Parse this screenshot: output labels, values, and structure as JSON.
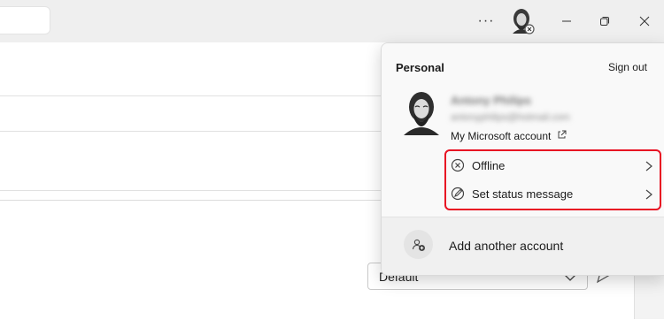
{
  "titlebar": {
    "more_label": "···",
    "window_controls": [
      "minimize-icon",
      "maximize-icon",
      "close-icon"
    ]
  },
  "compose": {
    "dropdown_value": "Default"
  },
  "account_menu": {
    "section_title": "Personal",
    "sign_out_label": "Sign out",
    "account_name": "Antony Philips",
    "account_email": "antonyphilips@hotmail.com",
    "ms_account_link": "My Microsoft account",
    "items": [
      {
        "label": "Offline",
        "icon": "offline-status-icon"
      },
      {
        "label": "Set status message",
        "icon": "status-message-icon"
      }
    ],
    "add_account_label": "Add another account"
  },
  "colors": {
    "highlight": "#e81123",
    "titlebar_bg": "#efefef",
    "flyout_bg": "#f9f9f9"
  }
}
